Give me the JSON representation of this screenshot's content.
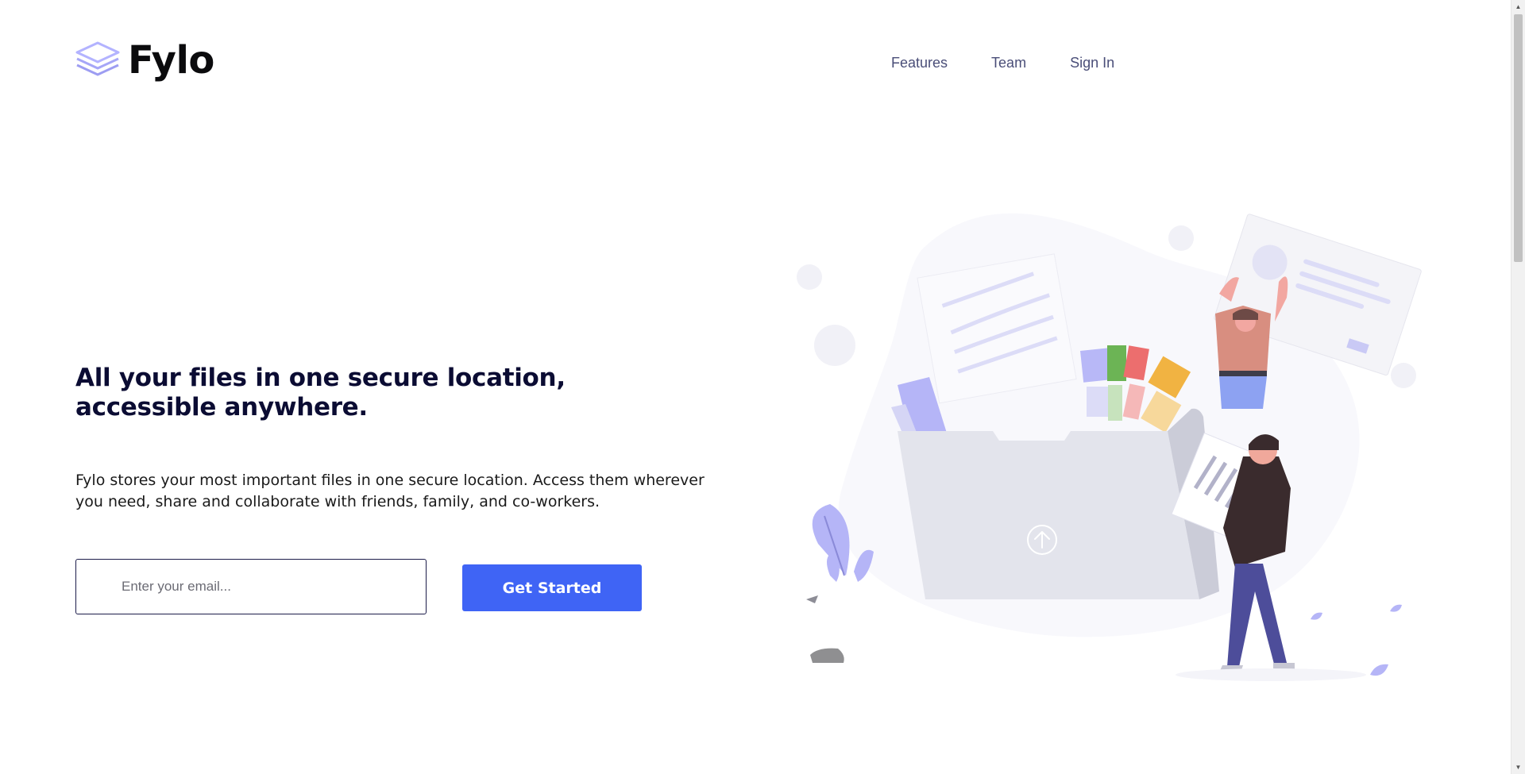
{
  "brand": {
    "name": "Fylo",
    "accent_color": "#a5a5ff",
    "logo_icon": "stacked-layers-icon"
  },
  "nav": {
    "items": [
      {
        "label": "Features"
      },
      {
        "label": "Team"
      },
      {
        "label": "Sign In"
      }
    ],
    "link_color": "#4a4e78"
  },
  "hero": {
    "headline": "All your files in one secure location, accessible anywhere.",
    "description": "Fylo stores your most important files in one secure location. Access them wherever you need, share and collaborate with friends, family, and co-workers.",
    "email_placeholder": "Enter your email...",
    "email_value": "",
    "cta_label": "Get Started",
    "cta_color": "#3f64f5",
    "headline_color": "#0b0c33"
  },
  "illustration": {
    "name": "illustration-intro",
    "upload_icon": "upload-arrow-icon"
  }
}
